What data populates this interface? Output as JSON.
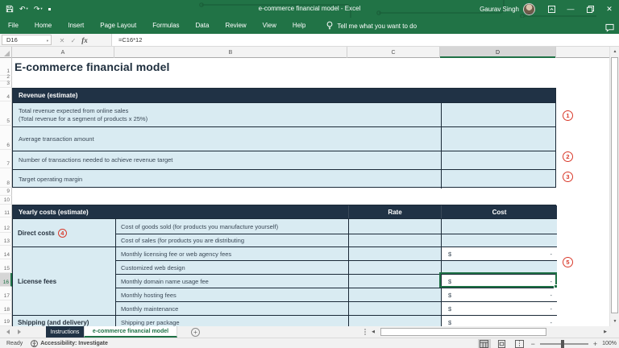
{
  "window": {
    "title": "e-commerce financial model  -  Excel",
    "user_name": "Gaurav Singh"
  },
  "ribbon": {
    "tabs": [
      "File",
      "Home",
      "Insert",
      "Page Layout",
      "Formulas",
      "Data",
      "Review",
      "View",
      "Help"
    ],
    "tell_me_label": "Tell me what you want to do"
  },
  "formula_bar": {
    "name_box_value": "D16",
    "fx_label": "fx",
    "formula": "=C16*12"
  },
  "grid": {
    "column_letters": [
      "A",
      "B",
      "C",
      "D"
    ],
    "row_numbers": [
      "1",
      "2",
      "3",
      "4",
      "5",
      "6",
      "7",
      "8",
      "9",
      "10",
      "11",
      "12",
      "13",
      "14",
      "15",
      "16",
      "17",
      "18",
      "19"
    ],
    "selected_cell": "D16"
  },
  "sheet": {
    "title": "E-commerce financial model",
    "revenue": {
      "header": "Revenue (estimate)",
      "rows": [
        {
          "label": "Total revenue expected from online sales",
          "label2": "(Total revenue for a segment of products x 25%)",
          "annotation": "1",
          "value": ""
        },
        {
          "label": "Average transaction amount",
          "value": ""
        },
        {
          "label": "Number of transactions needed to achieve revenue target",
          "annotation": "2",
          "value": ""
        },
        {
          "label": "Target operating margin",
          "annotation": "3",
          "value": ""
        }
      ]
    },
    "costs": {
      "header": "Yearly costs (estimate)",
      "rate_header": "Rate",
      "cost_header": "Cost",
      "groups": [
        {
          "label": "Direct costs",
          "annotation": "4"
        },
        {
          "label": "License fees"
        },
        {
          "label": "Shipping (and delivery)"
        }
      ],
      "rows": [
        {
          "label": "Cost of goods sold (for products you manufacture yourself)",
          "rate": "",
          "cost_dollar": "",
          "cost_value": ""
        },
        {
          "label": "Cost of sales (for products you are distributing",
          "rate": "",
          "cost_dollar": "",
          "cost_value": ""
        },
        {
          "label": "Monthly licensing fee or web agency fees",
          "rate": "",
          "cost_dollar": "$",
          "cost_value": "-"
        },
        {
          "label": "Customized web design",
          "annotation": "5",
          "rate": "",
          "cost_dollar": "",
          "cost_value": ""
        },
        {
          "label": "Monthly domain name usage fee",
          "rate": "",
          "cost_dollar": "$",
          "cost_value": "-"
        },
        {
          "label": "Monthly hosting fees",
          "rate": "",
          "cost_dollar": "$",
          "cost_value": "-"
        },
        {
          "label": "Monthly maintenance",
          "rate": "",
          "cost_dollar": "$",
          "cost_value": "-"
        },
        {
          "label": "Shipping per package",
          "rate": "",
          "cost_dollar": "$",
          "cost_value": "-"
        }
      ]
    }
  },
  "sheet_tabs": {
    "items": [
      {
        "label": "Instructions",
        "active": false
      },
      {
        "label": "e-commerce financial model",
        "active": true
      }
    ]
  },
  "status_bar": {
    "mode": "Ready",
    "accessibility": "Accessibility: Investigate",
    "zoom_level": "100%"
  },
  "colors": {
    "excel_green": "#217346",
    "navy_header": "#203245",
    "light_blue": "#D9EBF2",
    "annotation_red": "#D93A2B"
  }
}
